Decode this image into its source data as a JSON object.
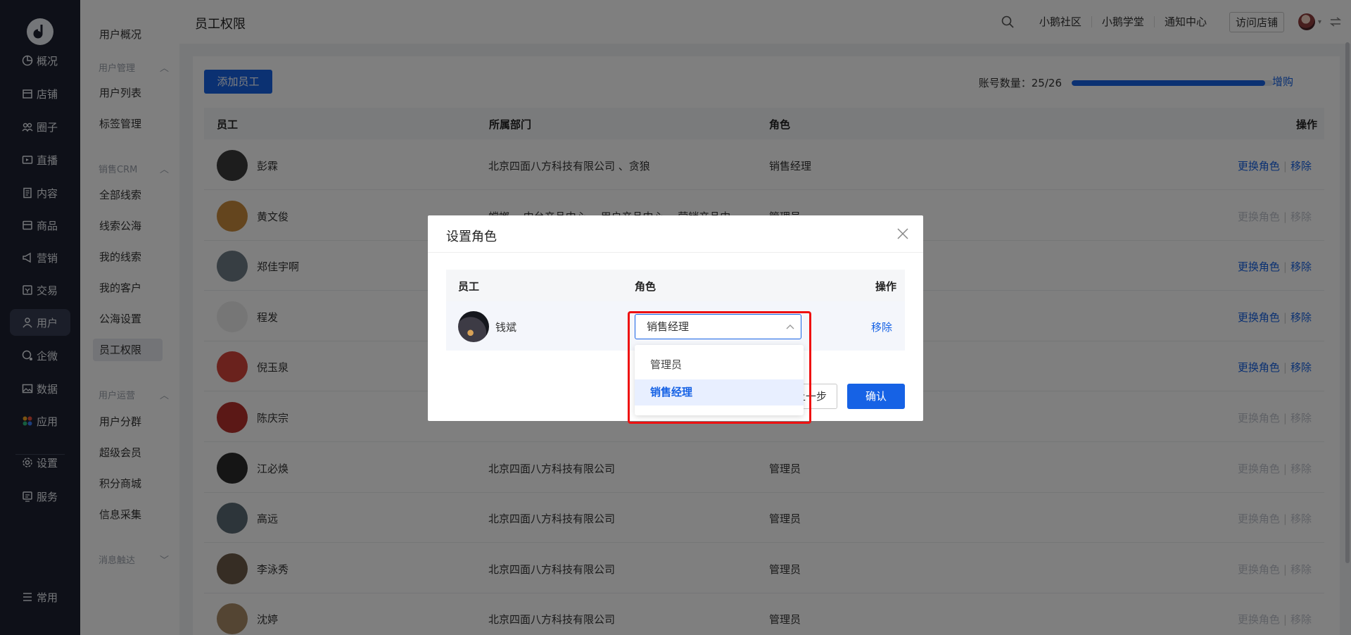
{
  "nav": {
    "items": [
      {
        "key": "overview",
        "label": "概况",
        "icon": "pie-chart-icon"
      },
      {
        "key": "store",
        "label": "店铺",
        "icon": "store-icon"
      },
      {
        "key": "circle",
        "label": "圈子",
        "icon": "group-icon"
      },
      {
        "key": "live",
        "label": "直播",
        "icon": "live-icon"
      },
      {
        "key": "content",
        "label": "内容",
        "icon": "document-icon"
      },
      {
        "key": "goods",
        "label": "商品",
        "icon": "box-icon"
      },
      {
        "key": "marketing",
        "label": "营销",
        "icon": "megaphone-icon"
      },
      {
        "key": "trade",
        "label": "交易",
        "icon": "trade-icon"
      },
      {
        "key": "user",
        "label": "用户",
        "icon": "user-icon",
        "active": true
      },
      {
        "key": "wecom",
        "label": "企微",
        "icon": "wecom-icon"
      },
      {
        "key": "data",
        "label": "数据",
        "icon": "image-icon"
      },
      {
        "key": "app",
        "label": "应用",
        "icon": "apps-icon"
      },
      {
        "key": "settings",
        "label": "设置",
        "icon": "gear-icon"
      },
      {
        "key": "service",
        "label": "服务",
        "icon": "service-icon"
      },
      {
        "key": "common",
        "label": "常用",
        "icon": "list-icon"
      }
    ]
  },
  "subnav": {
    "overview": "用户概况",
    "group_user_mgmt": "用户管理",
    "user_list": "用户列表",
    "tag_mgmt": "标签管理",
    "group_crm": "销售CRM",
    "all_leads": "全部线索",
    "lead_pool": "线索公海",
    "my_leads": "我的线索",
    "my_customers": "我的客户",
    "pool_settings": "公海设置",
    "staff_perm": "员工权限",
    "group_ops": "用户运营",
    "segments": "用户分群",
    "super_member": "超级会员",
    "points_mall": "积分商城",
    "info_collect": "信息采集",
    "group_msg": "消息触达"
  },
  "header": {
    "title": "员工权限",
    "links": [
      "小鹅社区",
      "小鹅学堂",
      "通知中心"
    ],
    "visit_store": "访问店铺"
  },
  "toolbar": {
    "add_staff": "添加员工",
    "account_count": "账号数量：25/26",
    "account_used": 25,
    "account_total": 26,
    "upgrade": "增购"
  },
  "table": {
    "columns": {
      "staff": "员工",
      "dept": "所属部门",
      "role": "角色",
      "ops": "操作"
    },
    "change_role": "更换角色",
    "remove": "移除",
    "rows": [
      {
        "name": "彭霖",
        "dept": "北京四面八方科技有限公司 、贪狼",
        "role": "销售经理",
        "enabled": true,
        "avatar": "#3a3a3a"
      },
      {
        "name": "黄文俊",
        "dept": "螳螂 、中台产品中心 、用户产品中心 、营销产品中",
        "role": "管理员",
        "enabled": false,
        "avatar": "#c98b3c"
      },
      {
        "name": "郑佳宇啊",
        "dept": "",
        "role": "",
        "enabled": true,
        "avatar": "#6f7c86"
      },
      {
        "name": "程发",
        "dept": "",
        "role": "",
        "enabled": true,
        "avatar": "#ededed"
      },
      {
        "name": "倪玉泉",
        "dept": "",
        "role": "",
        "enabled": true,
        "avatar": "#d4453a"
      },
      {
        "name": "陈庆宗",
        "dept": "",
        "role": "",
        "enabled": false,
        "avatar": "#b7312c"
      },
      {
        "name": "江必焕",
        "dept": "北京四面八方科技有限公司",
        "role": "管理员",
        "enabled": false,
        "avatar": "#2b2b2b"
      },
      {
        "name": "高远",
        "dept": "北京四面八方科技有限公司",
        "role": "管理员",
        "enabled": false,
        "avatar": "#5b6b74"
      },
      {
        "name": "李泳秀",
        "dept": "北京四面八方科技有限公司",
        "role": "管理员",
        "enabled": false,
        "avatar": "#6d5b49"
      },
      {
        "name": "沈婷",
        "dept": "北京四面八方科技有限公司",
        "role": "管理员",
        "enabled": false,
        "avatar": "#a88a66"
      }
    ]
  },
  "modal": {
    "title": "设置角色",
    "columns": {
      "staff": "员工",
      "role": "角色",
      "ops": "操作"
    },
    "row": {
      "name": "钱斌",
      "role": "销售经理",
      "remove": "移除"
    },
    "prev": "上一步",
    "confirm": "确认",
    "options": [
      "管理员",
      "销售经理"
    ],
    "selected": "销售经理"
  },
  "colors": {
    "primary": "#1662e5",
    "highlight": "#ee1111",
    "nav_bg": "#1d2130"
  }
}
